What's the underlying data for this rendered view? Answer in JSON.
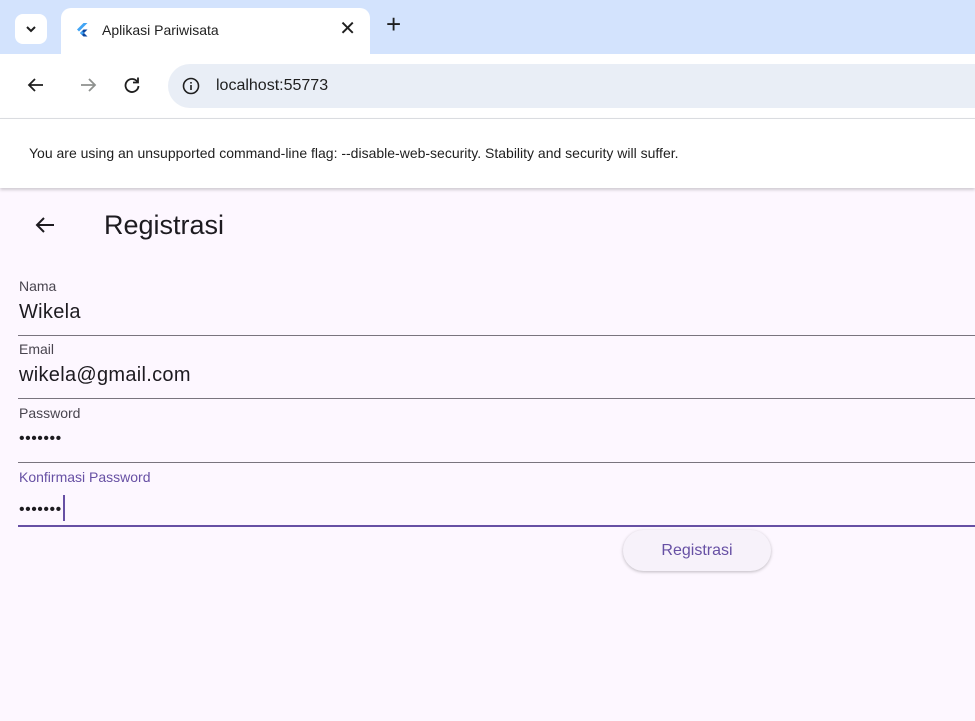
{
  "browser": {
    "tab": {
      "title": "Aplikasi Pariwisata",
      "close_glyph": "✕"
    },
    "new_tab_glyph": "+",
    "url": "localhost:55773",
    "infobar_message": "You are using an unsupported command-line flag: --disable-web-security. Stability and security will suffer.",
    "icons": [
      "chevron-down-icon",
      "flutter-logo-icon",
      "close-icon",
      "plus-icon",
      "back-arrow-icon",
      "forward-arrow-icon",
      "reload-icon",
      "info-icon"
    ]
  },
  "app": {
    "title": "Registrasi",
    "fields": [
      {
        "label": "Nama",
        "value": "Wikela"
      },
      {
        "label": "Email",
        "value": "wikela@gmail.com"
      },
      {
        "label": "Password",
        "value": "•••••••"
      },
      {
        "label": "Konfirmasi Password",
        "value": "•••••••"
      }
    ],
    "submit_label": "Registrasi",
    "colors": {
      "primary": "#6750a4",
      "surface": "#fdf7ff",
      "browser_frame": "#d3e3fd"
    }
  }
}
